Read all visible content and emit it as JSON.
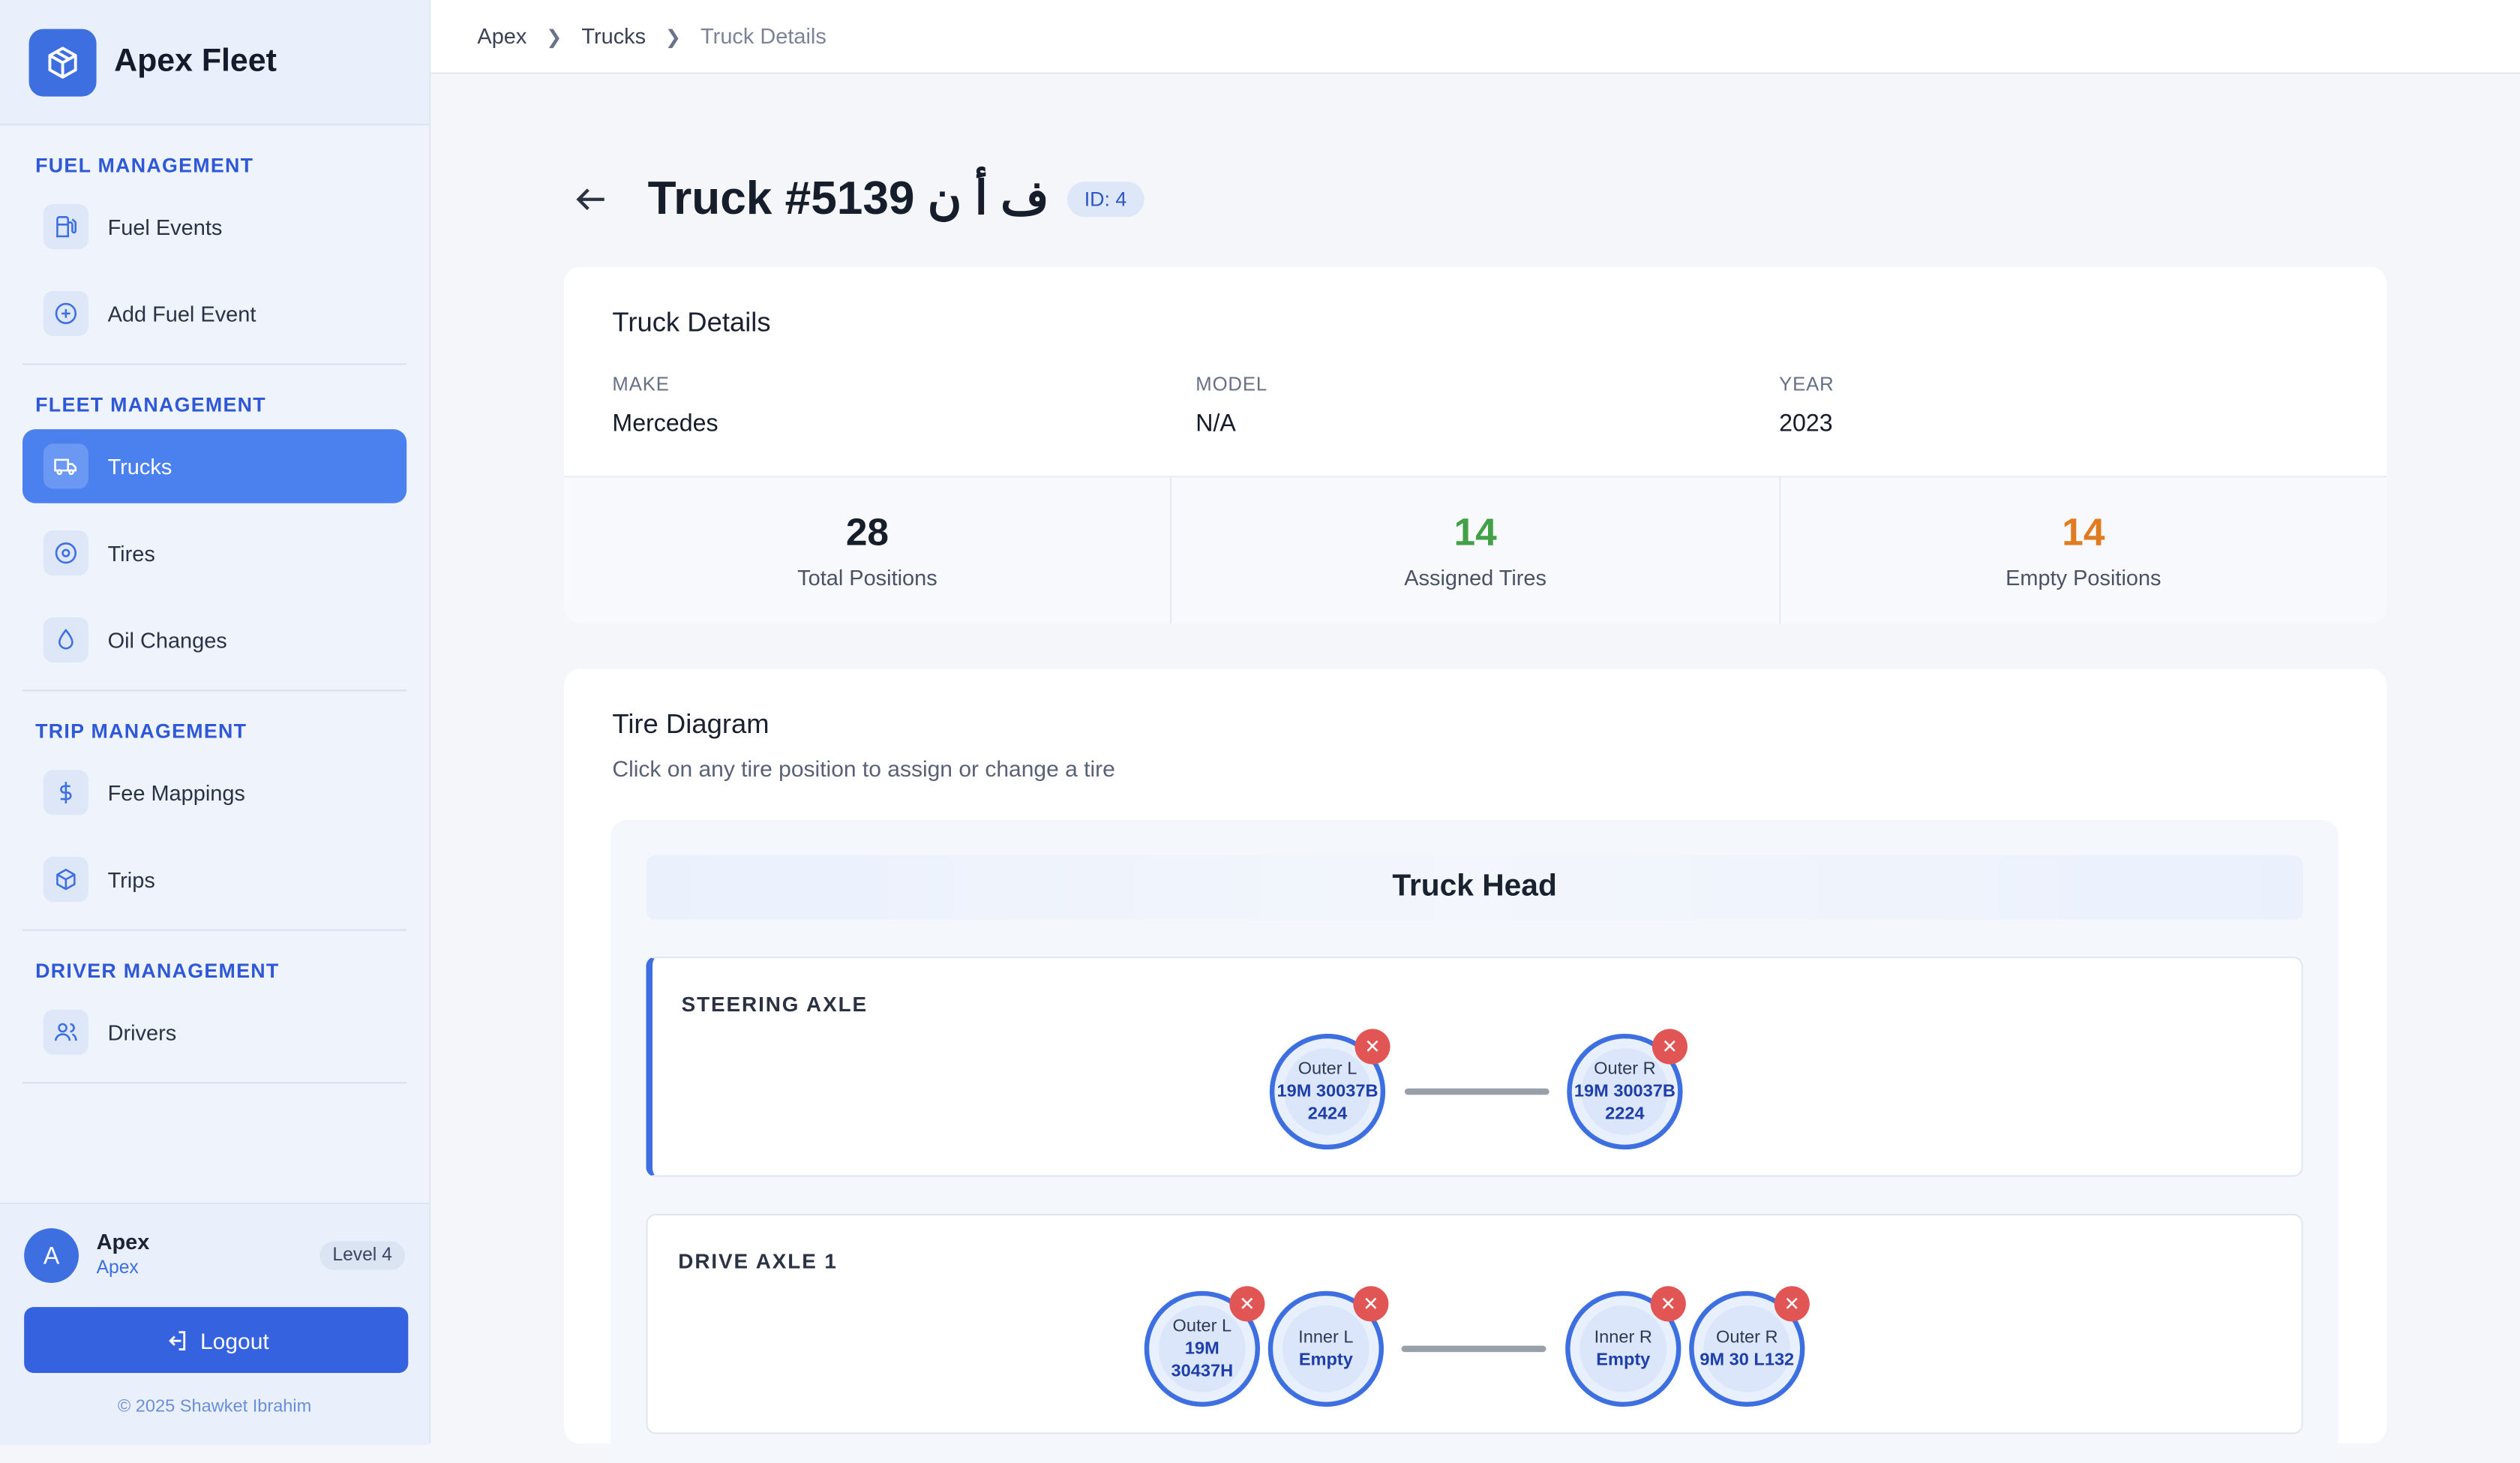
{
  "brand": {
    "name": "Apex Fleet",
    "logo_icon": "box-icon",
    "accent": "#3d6fe0"
  },
  "sidebar": {
    "sections": [
      {
        "title": "FUEL MANAGEMENT",
        "items": [
          {
            "label": "Fuel Events",
            "icon": "fuel-pump-icon"
          },
          {
            "label": "Add Fuel Event",
            "icon": "plus-circle-icon"
          }
        ]
      },
      {
        "title": "FLEET MANAGEMENT",
        "items": [
          {
            "label": "Trucks",
            "icon": "truck-icon",
            "active": true
          },
          {
            "label": "Tires",
            "icon": "tire-icon"
          },
          {
            "label": "Oil Changes",
            "icon": "droplet-icon"
          }
        ]
      },
      {
        "title": "TRIP MANAGEMENT",
        "items": [
          {
            "label": "Fee Mappings",
            "icon": "dollar-icon"
          },
          {
            "label": "Trips",
            "icon": "box-icon"
          }
        ]
      },
      {
        "title": "DRIVER MANAGEMENT",
        "items": [
          {
            "label": "Drivers",
            "icon": "users-icon"
          }
        ]
      }
    ]
  },
  "user": {
    "initial": "A",
    "name": "Apex",
    "sub": "Apex",
    "level": "Level 4",
    "logout_label": "Logout",
    "copyright": "© 2025 Shawket Ibrahim"
  },
  "breadcrumb": [
    "Apex",
    "Trucks",
    "Truck Details"
  ],
  "page": {
    "title": "Truck #5139 ف أ ن",
    "id_badge": "ID: 4"
  },
  "details": {
    "title": "Truck Details",
    "fields": [
      {
        "label": "MAKE",
        "value": "Mercedes"
      },
      {
        "label": "MODEL",
        "value": "N/A"
      },
      {
        "label": "YEAR",
        "value": "2023"
      }
    ],
    "stats": [
      {
        "value": "28",
        "label": "Total Positions",
        "color": "#161d2b"
      },
      {
        "value": "14",
        "label": "Assigned Tires",
        "color": "#43a047"
      },
      {
        "value": "14",
        "label": "Empty Positions",
        "color": "#e07b1f"
      }
    ]
  },
  "diagram": {
    "title": "Tire Diagram",
    "subtitle": "Click on any tire position to assign or change a tire",
    "head_label": "Truck Head",
    "axles": [
      {
        "title": "STEERING AXLE",
        "tires": [
          {
            "pos": "Outer L",
            "lines": [
              "19M 30037B",
              "2424"
            ]
          },
          {
            "pos": "Outer R",
            "lines": [
              "19M 30037B",
              "2224"
            ]
          }
        ]
      },
      {
        "title": "DRIVE AXLE 1",
        "tires": [
          {
            "pos": "Outer L",
            "lines": [
              "19M",
              "30437H"
            ]
          },
          {
            "pos": "Inner L",
            "lines": [
              "Empty"
            ]
          },
          {
            "pos": "Inner R",
            "lines": [
              "Empty"
            ]
          },
          {
            "pos": "Outer R",
            "lines": [
              "9M 30 L132"
            ]
          }
        ]
      }
    ]
  }
}
